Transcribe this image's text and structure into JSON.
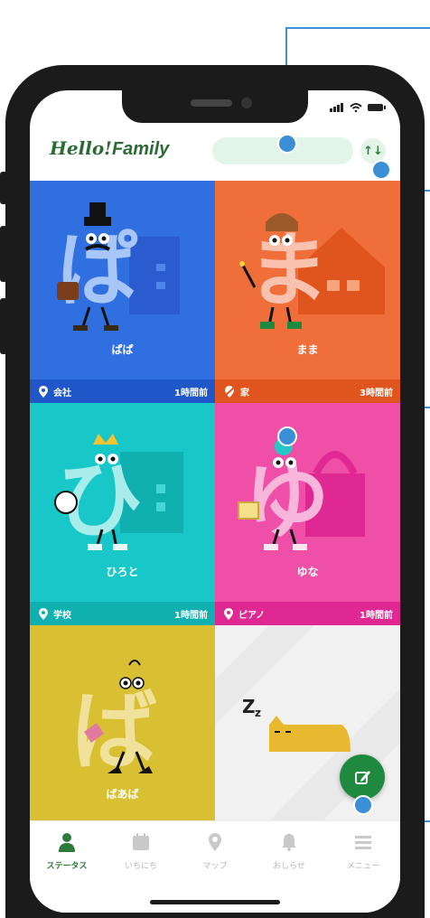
{
  "header": {
    "logo_hello": "Hello!",
    "logo_family": "Family",
    "sort_icon": "↑↓"
  },
  "tiles": [
    {
      "name": "ぱぱ",
      "location": "会社",
      "time": "1時間前",
      "color": "#2f6fe0",
      "bar": "#1f57c9",
      "location_icon": "pin-icon",
      "character": "ぱ"
    },
    {
      "name": "まま",
      "location": "家",
      "time": "3時間前",
      "color": "#f06e3a",
      "bar": "#e0551d",
      "location_icon": "pin-off-icon",
      "character": "ま"
    },
    {
      "name": "ひろと",
      "location": "学校",
      "time": "1時間前",
      "color": "#18c7c7",
      "bar": "#10b0b0",
      "location_icon": "pin-icon",
      "character": "ひ"
    },
    {
      "name": "ゆな",
      "location": "ピアノ",
      "time": "1時間前",
      "color": "#f04fa8",
      "bar": "#e02893",
      "location_icon": "pin-icon",
      "character": "ゆ"
    },
    {
      "name": "ばあば",
      "color": "#d8c032",
      "character": "ば"
    },
    {
      "sleep_text": "Z",
      "sleep_text_small": "z",
      "color": "#f1f1f1"
    }
  ],
  "tabs": [
    {
      "label": "ステータス",
      "icon": "person-icon",
      "active": true
    },
    {
      "label": "いちにち",
      "icon": "calendar-icon",
      "active": false
    },
    {
      "label": "マップ",
      "icon": "map-pin-icon",
      "active": false
    },
    {
      "label": "おしらせ",
      "icon": "bell-icon",
      "active": false
    },
    {
      "label": "メニュー",
      "icon": "menu-icon",
      "active": false
    }
  ],
  "colors": {
    "brand": "#2d7a3a",
    "callout": "#3a8fd6",
    "fab": "#1f8a3f"
  }
}
